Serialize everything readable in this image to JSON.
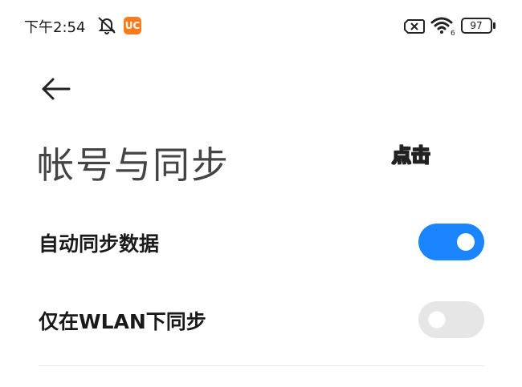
{
  "status_bar": {
    "time": "下午2:54",
    "app_badge": "UC",
    "battery": "97"
  },
  "header": {
    "title": "帐号与同步"
  },
  "annotation": {
    "tap_hint": "点击"
  },
  "settings": [
    {
      "label": "自动同步数据",
      "enabled": true
    },
    {
      "label": "仅在WLAN下同步",
      "enabled": false
    }
  ],
  "colors": {
    "accent": "#1a85ff",
    "toggle_off": "#e6e6e6",
    "hint_text": "#ffe11a"
  },
  "icons": {
    "back": "arrow-left-icon",
    "mute": "bell-off-icon",
    "sim": "sim-x-icon",
    "wifi": "wifi-icon",
    "battery": "battery-icon"
  }
}
